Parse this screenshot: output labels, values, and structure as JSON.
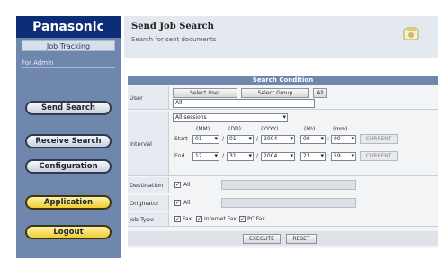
{
  "sidebar": {
    "brand": "Panasonic",
    "subtitle": "Job Tracking",
    "user": "For Admin",
    "buttons": {
      "send_search": "Send Search",
      "receive_search": "Receive Search",
      "configuration": "Configuration",
      "application": "Application",
      "logout": "Logout"
    }
  },
  "header": {
    "title": "Send Job Search",
    "subtitle": "Search for sent documents"
  },
  "form": {
    "heading": "Search Condition",
    "user": {
      "label": "User",
      "select_user": "Select User",
      "select_group": "Select Group",
      "all": "All",
      "value": "All"
    },
    "schedule": {
      "label": "Interval",
      "dropdown": "All sessions",
      "headers": [
        "(MM)",
        "(DD)",
        "(YYYY)",
        "(hh)",
        "(mm)"
      ],
      "start_label": "Start",
      "end_label": "End",
      "start": [
        "01",
        "01",
        "2004",
        "00",
        "00"
      ],
      "end": [
        "12",
        "31",
        "2004",
        "23",
        "59"
      ],
      "today_start": "CURRENT",
      "today_end": "CURRENT"
    },
    "destination": {
      "label": "Destination",
      "all": "All"
    },
    "originator": {
      "label": "Originator",
      "all": "All"
    },
    "job_type": {
      "label": "Job Type",
      "options": [
        "Fax",
        "Internet Fax",
        "PC Fax"
      ]
    },
    "buttons": {
      "execute": "EXECUTE",
      "reset": "RESET"
    }
  }
}
